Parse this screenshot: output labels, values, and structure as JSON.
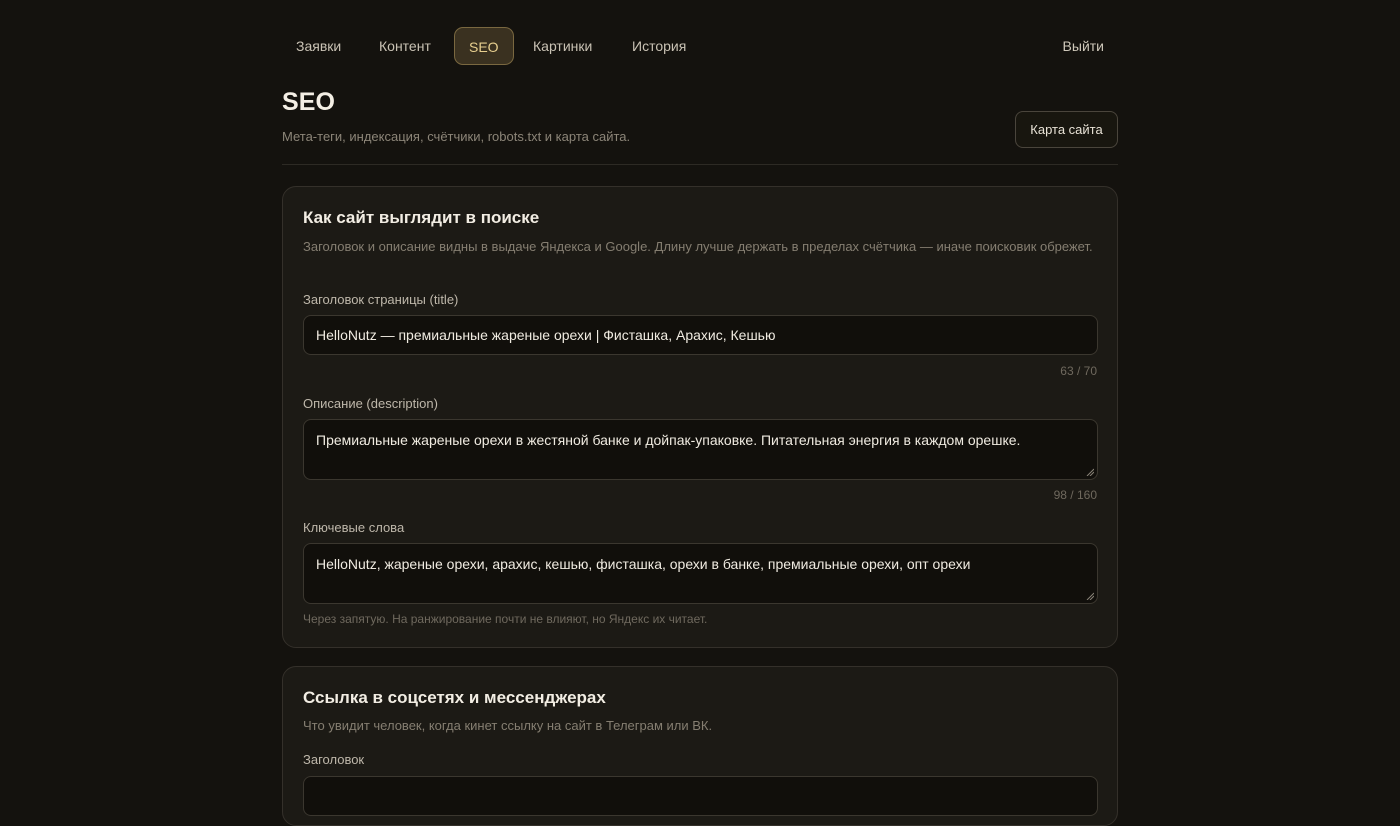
{
  "nav": {
    "items": [
      {
        "label": "Заявки"
      },
      {
        "label": "Контент"
      },
      {
        "label": "SEO"
      },
      {
        "label": "Картинки"
      },
      {
        "label": "История"
      }
    ],
    "active": "SEO",
    "logout_label": "Выйти"
  },
  "header": {
    "title": "SEO",
    "subtitle": "Мета-теги, индексация, счётчики, robots.txt и карта сайта.",
    "sitemap_button": "Карта сайта"
  },
  "search_card": {
    "title": "Как сайт выглядит в поиске",
    "description": "Заголовок и описание видны в выдаче Яндекса и Google. Длину лучше держать в пределах счётчика — иначе поисковик обрежет.",
    "title_field": {
      "label": "Заголовок страницы (title)",
      "value": "HelloNutz — премиальные жареные орехи | Фисташка, Арахис, Кешью",
      "counter": "63 / 70"
    },
    "description_field": {
      "label": "Описание (description)",
      "value": "Премиальные жареные орехи в жестяной банке и дойпак-упаковке. Питательная энергия в каждом орешке.",
      "counter": "98 / 160"
    },
    "keywords_field": {
      "label": "Ключевые слова",
      "value": "HelloNutz, жареные орехи, арахис, кешью, фисташка, орехи в банке, премиальные орехи, опт орехи",
      "hint": "Через запятую. На ранжирование почти не влияют, но Яндекс их читает."
    }
  },
  "social_card": {
    "title": "Ссылка в соцсетях и мессенджерах",
    "description": "Что увидит человек, когда кинет ссылку на сайт в Телеграм или ВК.",
    "title_field": {
      "label": "Заголовок",
      "value": ""
    }
  },
  "colors": {
    "background": "#14120e",
    "card": "#1c1a15",
    "accent": "#e7cf8f",
    "active_tab_bg": "#3a3120"
  }
}
